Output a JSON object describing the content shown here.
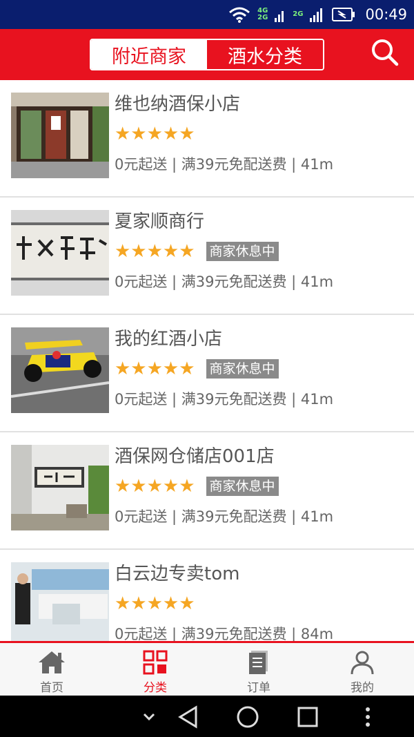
{
  "status_bar": {
    "time": "00:49",
    "net_top": "4G",
    "net_bottom": "2G",
    "net_2": "2G"
  },
  "header": {
    "tabs": [
      {
        "label": "附近商家",
        "active": true
      },
      {
        "label": "酒水分类",
        "active": false
      }
    ],
    "search_icon": "search-icon"
  },
  "stores": [
    {
      "name": "维也纳酒保小店",
      "stars": "★★★★★",
      "badge": "",
      "info": "0元起送 | 满39元免配送费 | 41m"
    },
    {
      "name": "夏家顺商行",
      "stars": "★★★★★",
      "badge": "商家休息中",
      "info": "0元起送 | 满39元免配送费 | 41m"
    },
    {
      "name": "我的红酒小店",
      "stars": "★★★★★",
      "badge": "商家休息中",
      "info": "0元起送 | 满39元免配送费 | 41m"
    },
    {
      "name": "酒保网仓储店001店",
      "stars": "★★★★★",
      "badge": "商家休息中",
      "info": "0元起送 | 满39元免配送费 | 41m"
    },
    {
      "name": "白云边专卖tom",
      "stars": "★★★★★",
      "badge": "",
      "info": "0元起送 | 满39元免配送费 | 84m"
    }
  ],
  "bottom_nav": [
    {
      "label": "首页",
      "icon": "home-icon",
      "active": false
    },
    {
      "label": "分类",
      "icon": "category-icon",
      "active": true
    },
    {
      "label": "订单",
      "icon": "order-icon",
      "active": false
    },
    {
      "label": "我的",
      "icon": "user-icon",
      "active": false
    }
  ],
  "colors": {
    "brand": "#e8121f",
    "star": "#f5a623",
    "badge": "#8a8a8a",
    "status_bar": "#0a1e6e"
  }
}
